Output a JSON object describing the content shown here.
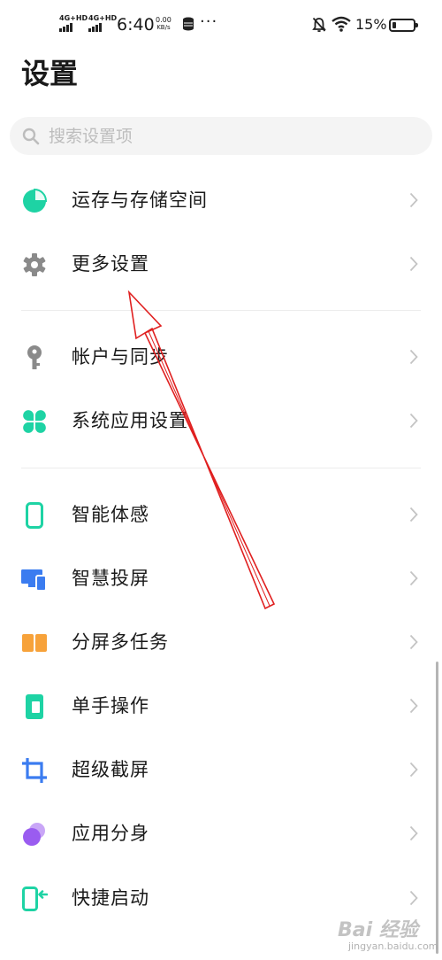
{
  "status_bar": {
    "sim1": "4G+HD",
    "sim2": "4G+HD",
    "time": "6:40",
    "speed_value": "0.00",
    "speed_unit": "KB/s",
    "more": "···",
    "battery_percent": "15%",
    "battery_level": 0.15
  },
  "title": "设置",
  "search": {
    "placeholder": "搜索设置项"
  },
  "groups": [
    [
      {
        "label": "运存与存储空间",
        "icon": "pie-chart-icon",
        "color": "#1ed3a4"
      },
      {
        "label": "更多设置",
        "icon": "gear-icon",
        "color": "#8a8a8a"
      }
    ],
    [
      {
        "label": "帐户与同步",
        "icon": "key-icon",
        "color": "#8a8a8a"
      },
      {
        "label": "系统应用设置",
        "icon": "clover-icon",
        "color": "#1ed3a4"
      }
    ],
    [
      {
        "label": "智能体感",
        "icon": "phone-outline-icon",
        "color": "#1ed3a4"
      },
      {
        "label": "智慧投屏",
        "icon": "screen-cast-icon",
        "color": "#3b7cf0"
      },
      {
        "label": "分屏多任务",
        "icon": "split-screen-icon",
        "color": "#f7a23a"
      },
      {
        "label": "单手操作",
        "icon": "one-hand-icon",
        "color": "#1ed3a4"
      },
      {
        "label": "超级截屏",
        "icon": "crop-icon",
        "color": "#3b7cf0"
      },
      {
        "label": "应用分身",
        "icon": "app-clone-icon",
        "color": "#9a5cf0"
      },
      {
        "label": "快捷启动",
        "icon": "quick-launch-icon",
        "color": "#1ed3a4"
      }
    ]
  ],
  "annotation_arrow_color": "#e02020",
  "watermark": {
    "text": "Bai 经验",
    "url": "jingyan.baidu.com"
  }
}
